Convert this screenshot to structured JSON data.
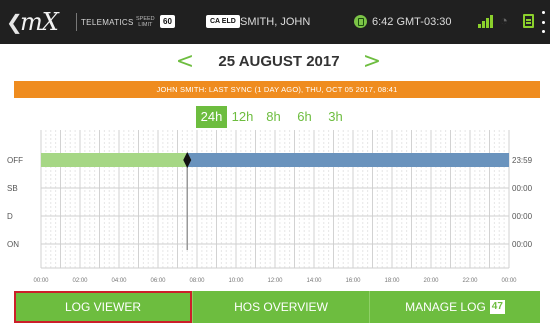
{
  "topbar": {
    "logo_text": "mX",
    "telematics_label": "TELEMATICS",
    "speed_label_1": "SPEED",
    "speed_label_2": "LIMIT",
    "speed_value": "60",
    "elo_badge": "CA ELD",
    "driver_name": "SMITH, JOHN",
    "clock": "6:42 GMT-03:30",
    "icons": [
      "back-chevron-icon",
      "driver-status-icon",
      "signal-icon",
      "wifi-icon",
      "card-icon",
      "more-icon"
    ]
  },
  "date_nav": {
    "prev": "<",
    "title": "25 AUGUST 2017",
    "next": ">"
  },
  "sync_banner": "JOHN SMITH: LAST SYNC (1 DAY AGO), THU, OCT 05 2017, 08:41",
  "range_tabs": [
    {
      "label": "24h",
      "active": true
    },
    {
      "label": "12h",
      "active": false
    },
    {
      "label": "8h",
      "active": false
    },
    {
      "label": "6h",
      "active": false
    },
    {
      "label": "3h",
      "active": false
    }
  ],
  "chart_data": {
    "type": "timeline",
    "rows": [
      "OFF",
      "SB",
      "D",
      "ON"
    ],
    "row_totals": [
      "23:59",
      "00:00",
      "00:00",
      "00:00"
    ],
    "x_ticks": [
      "00:00",
      "02:00",
      "04:00",
      "06:00",
      "08:00",
      "10:00",
      "12:00",
      "14:00",
      "16:00",
      "18:00",
      "20:00",
      "22:00",
      "00:00"
    ],
    "x_range_hours": [
      0,
      24
    ],
    "current_time_hours": 7.5,
    "segments": [
      {
        "row": "OFF",
        "start": 0,
        "end": 7.5,
        "color": "#a6d785"
      },
      {
        "row": "OFF",
        "start": 7.5,
        "end": 24,
        "color": "#6a93bd"
      }
    ],
    "grid": true
  },
  "bottom_bar": {
    "log_viewer": "LOG VIEWER",
    "hos_overview": "HOS OVERVIEW",
    "manage_log": "MANAGE LOG",
    "manage_log_count": "47"
  },
  "colors": {
    "accent_green": "#6dbd3f",
    "sync_orange": "#ef8c1f",
    "off_past": "#a6d785",
    "off_future": "#6a93bd",
    "selected_border": "#cc1f2a"
  }
}
